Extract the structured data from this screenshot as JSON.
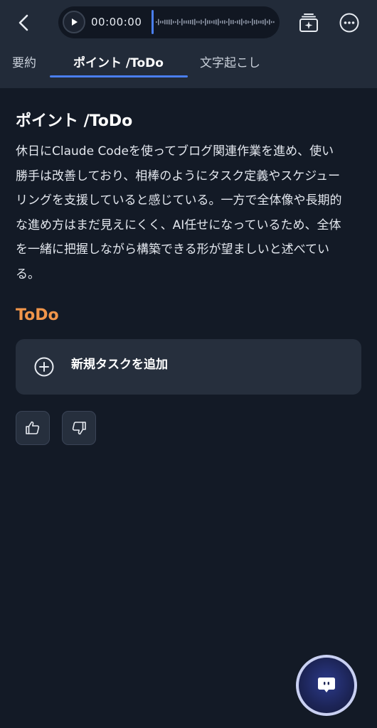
{
  "player": {
    "time": "00:00:00"
  },
  "tabs": [
    {
      "label": "要約"
    },
    {
      "label": "ポイント /ToDo"
    },
    {
      "label": "文字起こし"
    }
  ],
  "section": {
    "title": "ポイント /ToDo",
    "body_lines": [
      "休日にClaude Codeを使ってブログ関連作業を進め、使い",
      "勝手は改善しており、相棒のようにタスク定義やスケジュー",
      "リングを支援していると感じている。一方で全体像や長期的",
      "な進め方はまだ見えにくく、AI任せになっているため、全体",
      "を一緒に把握しながら構築できる形が望ましいと述べてい",
      "る。"
    ]
  },
  "todo": {
    "title": "ToDo",
    "add_label": "新規タスクを追加"
  },
  "icons": {
    "back": "chevron-left-icon",
    "play": "play-icon",
    "cards": "sparkle-cards-icon",
    "more": "more-horizontal-icon",
    "add": "plus-circle-icon",
    "like": "thumbs-up-icon",
    "dislike": "thumbs-down-icon",
    "chat": "chat-bubble-icon"
  },
  "colors": {
    "accent": "#4a7ff0",
    "todo_title": "#f0954a",
    "background": "#131a26",
    "header": "#222b39"
  }
}
